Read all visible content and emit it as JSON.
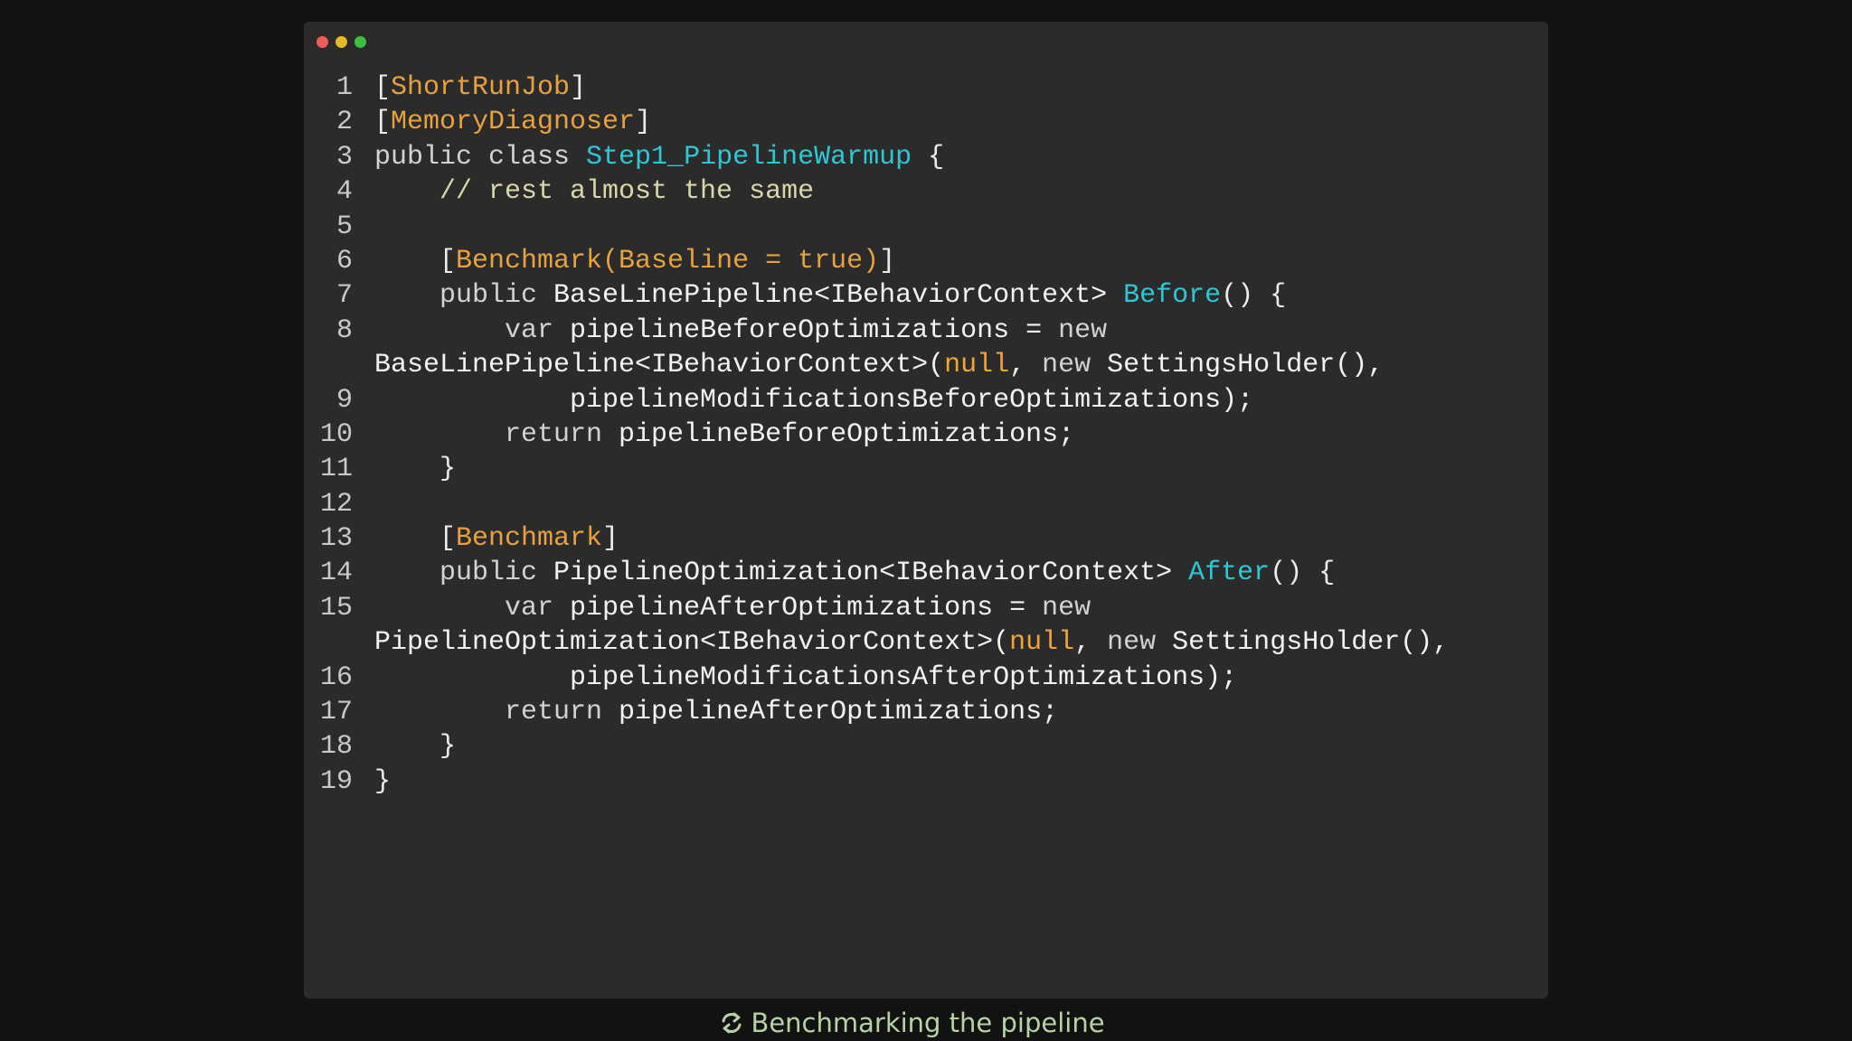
{
  "window": {
    "controls": [
      "close",
      "minimize",
      "maximize"
    ],
    "colors": {
      "close": "#ed5e56",
      "minimize": "#e8b828",
      "maximize": "#3cc040"
    }
  },
  "code": {
    "lines": [
      {
        "num": "1",
        "tokens": [
          {
            "t": "[",
            "c": "pun"
          },
          {
            "t": "ShortRunJob",
            "c": "attr"
          },
          {
            "t": "]",
            "c": "pun"
          }
        ]
      },
      {
        "num": "2",
        "tokens": [
          {
            "t": "[",
            "c": "pun"
          },
          {
            "t": "MemoryDiagnoser",
            "c": "attr"
          },
          {
            "t": "]",
            "c": "pun"
          }
        ]
      },
      {
        "num": "3",
        "tokens": [
          {
            "t": "public class ",
            "c": "kw"
          },
          {
            "t": "Step1_PipelineWarmup",
            "c": "cls"
          },
          {
            "t": " {",
            "c": "pun"
          }
        ]
      },
      {
        "num": "4",
        "tokens": [
          {
            "t": "    // rest almost the same",
            "c": "cmt"
          }
        ]
      },
      {
        "num": "5",
        "tokens": []
      },
      {
        "num": "6",
        "tokens": [
          {
            "t": "    [",
            "c": "pun"
          },
          {
            "t": "Benchmark(Baseline = true)",
            "c": "attr"
          },
          {
            "t": "]",
            "c": "pun"
          }
        ]
      },
      {
        "num": "7",
        "tokens": [
          {
            "t": "    public ",
            "c": "kw"
          },
          {
            "t": "BaseLinePipeline<IBehaviorContext> ",
            "c": "id"
          },
          {
            "t": "Before",
            "c": "cls"
          },
          {
            "t": "() {",
            "c": "pun"
          }
        ]
      },
      {
        "num": "8",
        "tokens": [
          {
            "t": "        var ",
            "c": "kw"
          },
          {
            "t": "pipelineBeforeOptimizations = ",
            "c": "id"
          },
          {
            "t": "new",
            "c": "kw"
          }
        ]
      },
      {
        "num": "",
        "tokens": [
          {
            "t": "BaseLinePipeline<IBehaviorContext>(",
            "c": "id"
          },
          {
            "t": "null",
            "c": "lit"
          },
          {
            "t": ", ",
            "c": "pun"
          },
          {
            "t": "new ",
            "c": "kw"
          },
          {
            "t": "SettingsHolder(),",
            "c": "id"
          }
        ]
      },
      {
        "num": "9",
        "tokens": [
          {
            "t": "            pipelineModificationsBeforeOptimizations);",
            "c": "id"
          }
        ]
      },
      {
        "num": "10",
        "tokens": [
          {
            "t": "        return ",
            "c": "kw"
          },
          {
            "t": "pipelineBeforeOptimizations;",
            "c": "id"
          }
        ]
      },
      {
        "num": "11",
        "tokens": [
          {
            "t": "    }",
            "c": "pun"
          }
        ]
      },
      {
        "num": "12",
        "tokens": []
      },
      {
        "num": "13",
        "tokens": [
          {
            "t": "    [",
            "c": "pun"
          },
          {
            "t": "Benchmark",
            "c": "attr"
          },
          {
            "t": "]",
            "c": "pun"
          }
        ]
      },
      {
        "num": "14",
        "tokens": [
          {
            "t": "    public ",
            "c": "kw"
          },
          {
            "t": "PipelineOptimization<IBehaviorContext> ",
            "c": "id"
          },
          {
            "t": "After",
            "c": "cls"
          },
          {
            "t": "() {",
            "c": "pun"
          }
        ]
      },
      {
        "num": "15",
        "tokens": [
          {
            "t": "        var ",
            "c": "kw"
          },
          {
            "t": "pipelineAfterOptimizations = ",
            "c": "id"
          },
          {
            "t": "new",
            "c": "kw"
          }
        ]
      },
      {
        "num": "",
        "tokens": [
          {
            "t": "PipelineOptimization<IBehaviorContext>(",
            "c": "id"
          },
          {
            "t": "null",
            "c": "lit"
          },
          {
            "t": ", ",
            "c": "pun"
          },
          {
            "t": "new ",
            "c": "kw"
          },
          {
            "t": "SettingsHolder(),",
            "c": "id"
          }
        ]
      },
      {
        "num": "16",
        "tokens": [
          {
            "t": "            pipelineModificationsAfterOptimizations);",
            "c": "id"
          }
        ]
      },
      {
        "num": "17",
        "tokens": [
          {
            "t": "        return ",
            "c": "kw"
          },
          {
            "t": "pipelineAfterOptimizations;",
            "c": "id"
          }
        ]
      },
      {
        "num": "18",
        "tokens": [
          {
            "t": "    }",
            "c": "pun"
          }
        ]
      },
      {
        "num": "19",
        "tokens": [
          {
            "t": "}",
            "c": "pun"
          }
        ]
      }
    ]
  },
  "caption": {
    "icon": "refresh-icon",
    "text": "Benchmarking the pipeline"
  }
}
